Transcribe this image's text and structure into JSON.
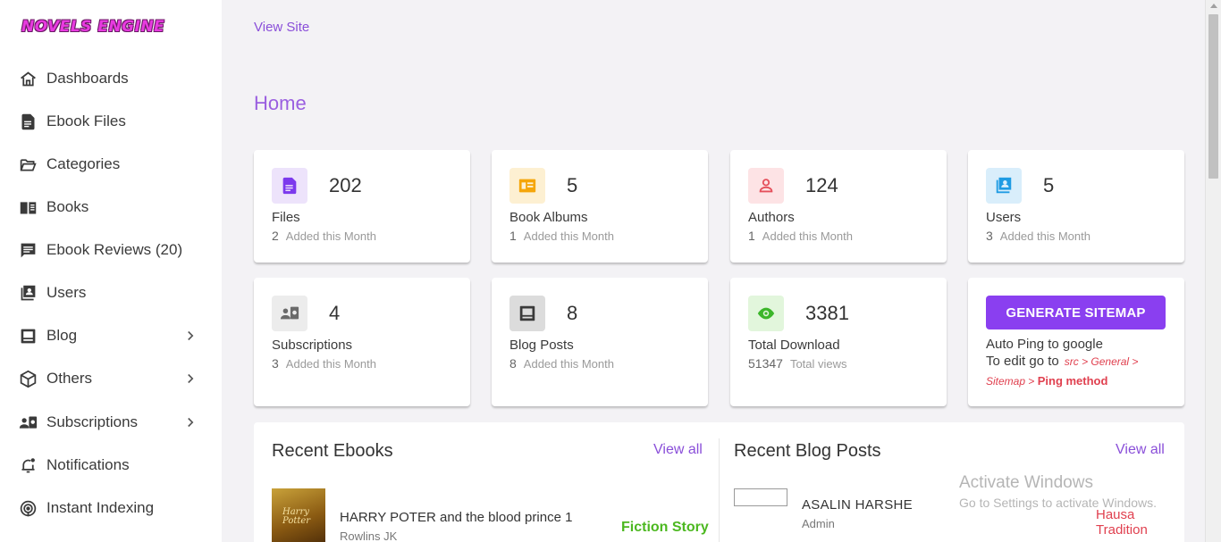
{
  "app": {
    "logo_text": "NOVELS ENGINE"
  },
  "sidebar": {
    "items": [
      {
        "label": "Dashboards",
        "icon": "home-icon"
      },
      {
        "label": "Ebook Files",
        "icon": "file-icon"
      },
      {
        "label": "Categories",
        "icon": "folder-open-icon"
      },
      {
        "label": "Books",
        "icon": "book-icon"
      },
      {
        "label": "Ebook Reviews (20)",
        "icon": "review-icon"
      },
      {
        "label": "Users",
        "icon": "users-icon"
      },
      {
        "label": "Blog",
        "icon": "blog-icon",
        "has_children": true
      },
      {
        "label": "Others",
        "icon": "box-icon",
        "has_children": true
      },
      {
        "label": "Subscriptions",
        "icon": "subscriptions-icon",
        "has_children": true
      },
      {
        "label": "Notifications",
        "icon": "bell-icon"
      },
      {
        "label": "Instant Indexing",
        "icon": "indexing-icon"
      }
    ]
  },
  "header": {
    "view_site": "View Site"
  },
  "page": {
    "title": "Home"
  },
  "stats": [
    {
      "value": "202",
      "name": "Files",
      "sub_count": "2",
      "sub_text": "Added this Month",
      "icon": "file-icon",
      "color": "#7c3aed",
      "bg": "#ede3fb"
    },
    {
      "value": "5",
      "name": "Book Albums",
      "sub_count": "1",
      "sub_text": "Added this Month",
      "icon": "album-icon",
      "color": "#f5a60a",
      "bg": "#fdf0d2"
    },
    {
      "value": "124",
      "name": "Authors",
      "sub_count": "1",
      "sub_text": "Added this Month",
      "icon": "person-icon",
      "color": "#e5505c",
      "bg": "#fde3e5"
    },
    {
      "value": "5",
      "name": "Users",
      "sub_count": "3",
      "sub_text": "Added this Month",
      "icon": "users-icon",
      "color": "#1e9be3",
      "bg": "#d9eefb"
    },
    {
      "value": "4",
      "name": "Subscriptions",
      "sub_count": "3",
      "sub_text": "Added this Month",
      "icon": "subscriptions-icon",
      "color": "#6a6a6a",
      "bg": "#ececec"
    },
    {
      "value": "8",
      "name": "Blog Posts",
      "sub_count": "8",
      "sub_text": "Added this Month",
      "icon": "blog-icon",
      "color": "#3a3a3a",
      "bg": "#dcdcdc"
    },
    {
      "value": "3381",
      "name": "Total Download",
      "sub_count": "51347",
      "sub_text": "Total views",
      "icon": "eye-icon",
      "color": "#3cb62a",
      "bg": "#e2f6dc"
    }
  ],
  "sitemap": {
    "button": "GENERATE SITEMAP",
    "line1": "Auto Ping to google",
    "line2_prefix": "To edit go to",
    "path_part1": "src > General >",
    "path_part2": "Sitemap",
    "path_sep": " > ",
    "path_method": "Ping method"
  },
  "recent_ebooks": {
    "title": "Recent Ebooks",
    "view_all": "View all",
    "items": [
      {
        "title": "HARRY POTER and the blood prince 1",
        "author": "Rowlins JK",
        "category": "Fiction Story",
        "cover_text": "Harry Potter"
      }
    ]
  },
  "recent_blog": {
    "title": "Recent Blog Posts",
    "view_all": "View all",
    "items": [
      {
        "title": "ASALIN HARSHE",
        "author": "Admin",
        "category": "Hausa Tradition"
      }
    ]
  },
  "os_watermark": {
    "line1": "Activate Windows",
    "line2": "Go to Settings to activate Windows."
  }
}
